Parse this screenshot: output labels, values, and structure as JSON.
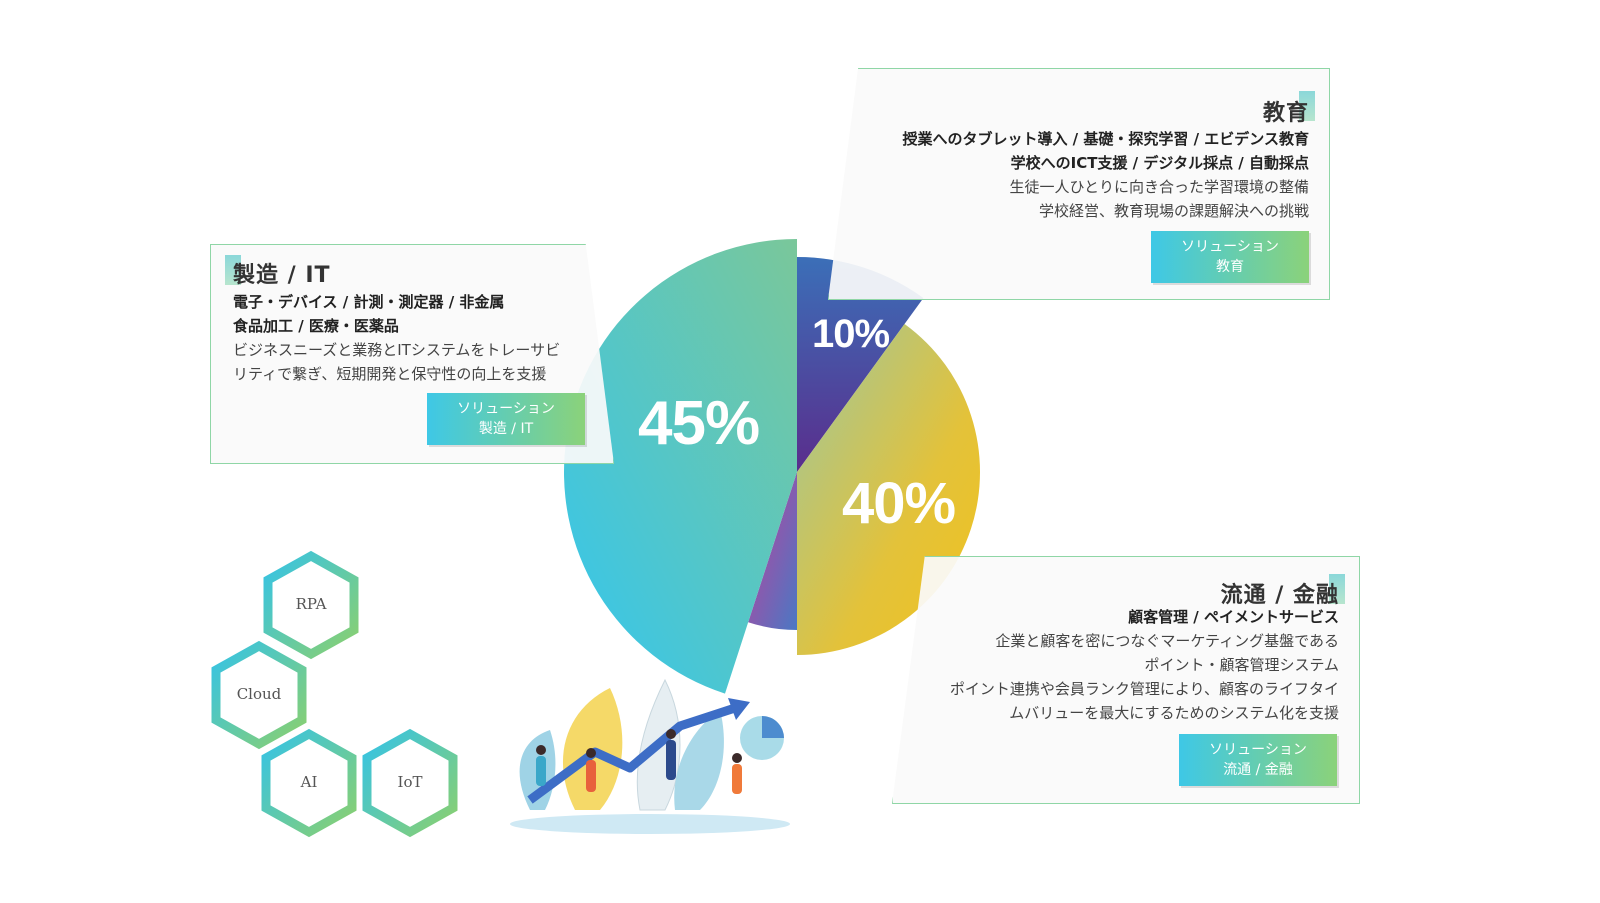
{
  "chart_data": {
    "type": "pie",
    "values": [
      10,
      40,
      45
    ],
    "labels": [
      "10%",
      "40%",
      "45%"
    ]
  },
  "cards": {
    "education": {
      "title": "教育",
      "bold_lines": [
        "授業へのタブレット導入 / 基礎・探究学習 / エビデンス教育",
        "学校へのICT支援 / デジタル採点 / 自動採点"
      ],
      "plain_lines": [
        "生徒一人ひとりに向き合った学習環境の整備",
        "学校経営、教育現場の課題解決への挑戦"
      ],
      "button_line1": "ソリューション",
      "button_line2": "教育"
    },
    "manufacturing": {
      "title": "製造 / IT",
      "bold_lines": [
        "電子・デバイス / 計測・測定器 / 非金属",
        "食品加工 / 医療・医薬品"
      ],
      "plain_lines": [
        "ビジネスニーズと業務とITシステムをトレーサビ",
        "リティで繋ぎ、短期開発と保守性の向上を支援"
      ],
      "button_line1": "ソリューション",
      "button_line2": "製造 / IT"
    },
    "finance": {
      "title": "流通 / 金融",
      "bold_lines": [
        "顧客管理 / ペイメントサービス"
      ],
      "plain_lines": [
        "企業と顧客を密につなぐマーケティング基盤である",
        "ポイント・顧客管理システム",
        "ポイント連携や会員ランク管理により、顧客のライフタイ",
        "ムバリューを最大にするためのシステム化を支援"
      ],
      "button_line1": "ソリューション",
      "button_line2": "流通 / 金融"
    }
  },
  "hexagons": [
    "RPA",
    "Cloud",
    "AI",
    "IoT"
  ]
}
